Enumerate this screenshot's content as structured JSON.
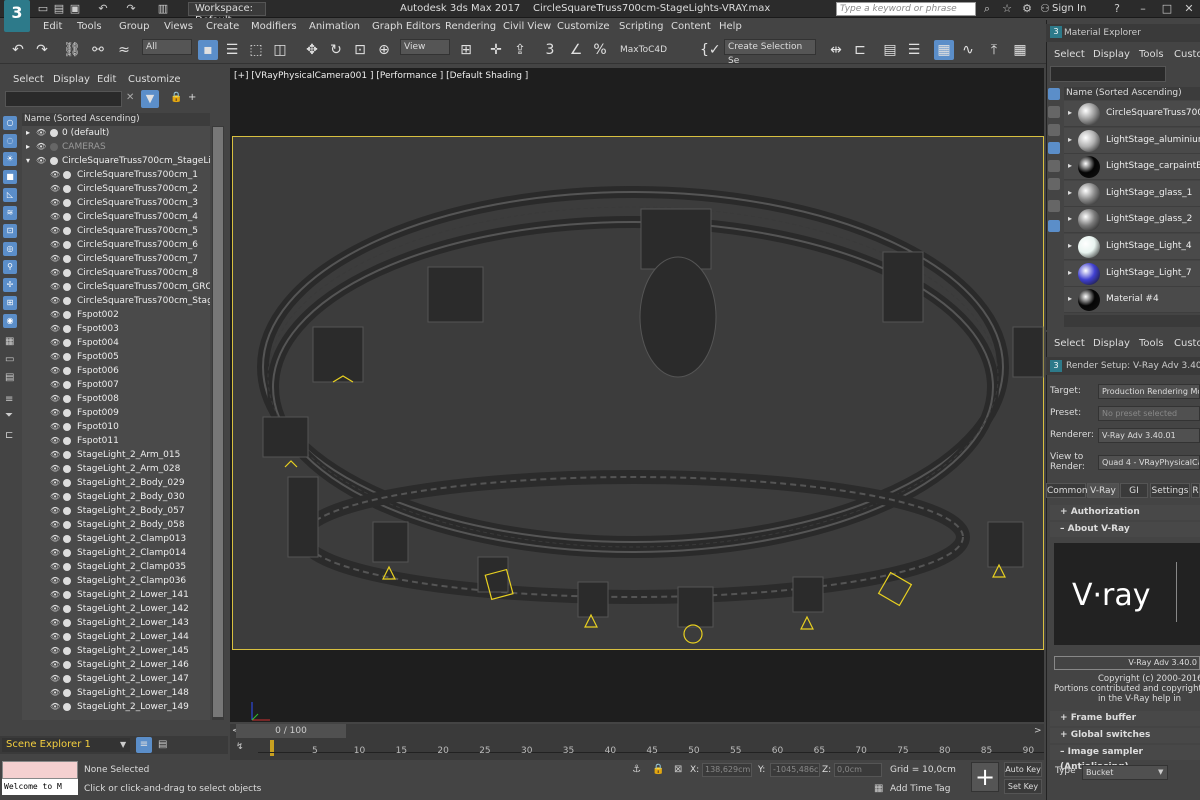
{
  "app": {
    "title": "Autodesk 3ds Max 2017",
    "file": "CircleSquareTruss700cm-StageLights-VRAY.max",
    "workspace": "Workspace: Default",
    "search_placeholder": "Type a keyword or phrase",
    "sign_in": "Sign In"
  },
  "menu": [
    "Edit",
    "Tools",
    "Group",
    "Views",
    "Create",
    "Modifiers",
    "Animation",
    "Graph Editors",
    "Rendering",
    "Civil View",
    "Customize",
    "Scripting",
    "Content",
    "Help"
  ],
  "toolbar": {
    "filter": "All",
    "view": "View",
    "maxtoc4d": "MaxToC4D",
    "selection_set": "Create Selection Se"
  },
  "scene_explorer": {
    "menu": [
      "Select",
      "Display",
      "Edit",
      "Customize"
    ],
    "column_header": "Name (Sorted Ascending)",
    "footer": "Scene Explorer 1",
    "rows": [
      {
        "name": "0 (default)",
        "level": 0
      },
      {
        "name": "CAMERAS",
        "level": 0
      },
      {
        "name": "CircleSquareTruss700cm_StageLights",
        "level": 0
      },
      {
        "name": "CircleSquareTruss700cm_1",
        "level": 1
      },
      {
        "name": "CircleSquareTruss700cm_2",
        "level": 1
      },
      {
        "name": "CircleSquareTruss700cm_3",
        "level": 1
      },
      {
        "name": "CircleSquareTruss700cm_4",
        "level": 1
      },
      {
        "name": "CircleSquareTruss700cm_5",
        "level": 1
      },
      {
        "name": "CircleSquareTruss700cm_6",
        "level": 1
      },
      {
        "name": "CircleSquareTruss700cm_7",
        "level": 1
      },
      {
        "name": "CircleSquareTruss700cm_8",
        "level": 1
      },
      {
        "name": "CircleSquareTruss700cm_GROUP",
        "level": 1
      },
      {
        "name": "CircleSquareTruss700cm_StageLigh",
        "level": 1
      },
      {
        "name": "Fspot002",
        "level": 1
      },
      {
        "name": "Fspot003",
        "level": 1
      },
      {
        "name": "Fspot004",
        "level": 1
      },
      {
        "name": "Fspot005",
        "level": 1
      },
      {
        "name": "Fspot006",
        "level": 1
      },
      {
        "name": "Fspot007",
        "level": 1
      },
      {
        "name": "Fspot008",
        "level": 1
      },
      {
        "name": "Fspot009",
        "level": 1
      },
      {
        "name": "Fspot010",
        "level": 1
      },
      {
        "name": "Fspot011",
        "level": 1
      },
      {
        "name": "StageLight_2_Arm_015",
        "level": 1
      },
      {
        "name": "StageLight_2_Arm_028",
        "level": 1
      },
      {
        "name": "StageLight_2_Body_029",
        "level": 1
      },
      {
        "name": "StageLight_2_Body_030",
        "level": 1
      },
      {
        "name": "StageLight_2_Body_057",
        "level": 1
      },
      {
        "name": "StageLight_2_Body_058",
        "level": 1
      },
      {
        "name": "StageLight_2_Clamp013",
        "level": 1
      },
      {
        "name": "StageLight_2_Clamp014",
        "level": 1
      },
      {
        "name": "StageLight_2_Clamp035",
        "level": 1
      },
      {
        "name": "StageLight_2_Clamp036",
        "level": 1
      },
      {
        "name": "StageLight_2_Lower_141",
        "level": 1
      },
      {
        "name": "StageLight_2_Lower_142",
        "level": 1
      },
      {
        "name": "StageLight_2_Lower_143",
        "level": 1
      },
      {
        "name": "StageLight_2_Lower_144",
        "level": 1
      },
      {
        "name": "StageLight_2_Lower_145",
        "level": 1
      },
      {
        "name": "StageLight_2_Lower_146",
        "level": 1
      },
      {
        "name": "StageLight_2_Lower_147",
        "level": 1
      },
      {
        "name": "StageLight_2_Lower_148",
        "level": 1
      },
      {
        "name": "StageLight_2_Lower_149",
        "level": 1
      }
    ]
  },
  "viewport": {
    "label": "[+] [VRayPhysicalCamera001 ] [Performance ] [Default Shading ]"
  },
  "timeline": {
    "frame": "0 / 100",
    "ticks": [
      "5",
      "10",
      "15",
      "20",
      "25",
      "30",
      "35",
      "40",
      "45",
      "50",
      "55",
      "60",
      "65",
      "70",
      "75",
      "80",
      "85",
      "90"
    ]
  },
  "status": {
    "maxscript": "Welcome to M",
    "selection": "None Selected",
    "prompt": "Click or click-and-drag to select objects",
    "x_label": "X:",
    "x": "138,629cm",
    "y_label": "Y:",
    "y": "-1045,486c",
    "z_label": "Z:",
    "z": "0,0cm",
    "grid": "Grid = 10,0cm",
    "add_time_tag": "Add Time Tag",
    "auto_key": "Auto Key",
    "set_key": "Set Key"
  },
  "material_explorer": {
    "title": "Material Explorer",
    "menu": [
      "Select",
      "Display",
      "Tools",
      "Custo"
    ],
    "column_header": "Name (Sorted Ascending)",
    "items": [
      {
        "name": "CircleSquareTruss700cm",
        "color": "#9a9a9a"
      },
      {
        "name": "LightStage_aluminium",
        "color": "#b0b0b0"
      },
      {
        "name": "LightStage_carpaintBlack",
        "color": "#050505"
      },
      {
        "name": "LightStage_glass_1",
        "color": "#8a8a8a"
      },
      {
        "name": "LightStage_glass_2",
        "color": "#7a7a7a"
      },
      {
        "name": "LightStage_Light_4",
        "color": "#e8f4f0"
      },
      {
        "name": "LightStage_Light_7",
        "color": "#4040d0"
      },
      {
        "name": "Material #4",
        "color": "#050505"
      }
    ]
  },
  "render_setup": {
    "menu": [
      "Select",
      "Display",
      "Tools",
      "Custo"
    ],
    "title": "Render Setup: V-Ray Adv 3.40.01",
    "target_label": "Target:",
    "target": "Production Rendering Mod",
    "preset_label": "Preset:",
    "preset": "No preset selected",
    "renderer_label": "Renderer:",
    "renderer": "V-Ray Adv 3.40.01",
    "view_label1": "View to",
    "view_label2": "Render:",
    "view": "Quad 4 - VRayPhysicalCam",
    "tabs": [
      "Common",
      "V-Ray",
      "GI",
      "Settings",
      "R"
    ],
    "rollouts": {
      "authorization": "Authorization",
      "about": "About V-Ray",
      "frame_buffer": "Frame buffer",
      "global_switches": "Global switches",
      "image_sampler": "Image sampler (Antialiasing)"
    },
    "logo": "V·ray",
    "version": "V-Ray Adv 3.40.0",
    "copyright1": "Copyright (c) 2000-2016, C",
    "copyright2": "Portions contributed and copyrights he",
    "copyright3": "in the V-Ray help in",
    "type_label": "Type",
    "type": "Bucket"
  }
}
